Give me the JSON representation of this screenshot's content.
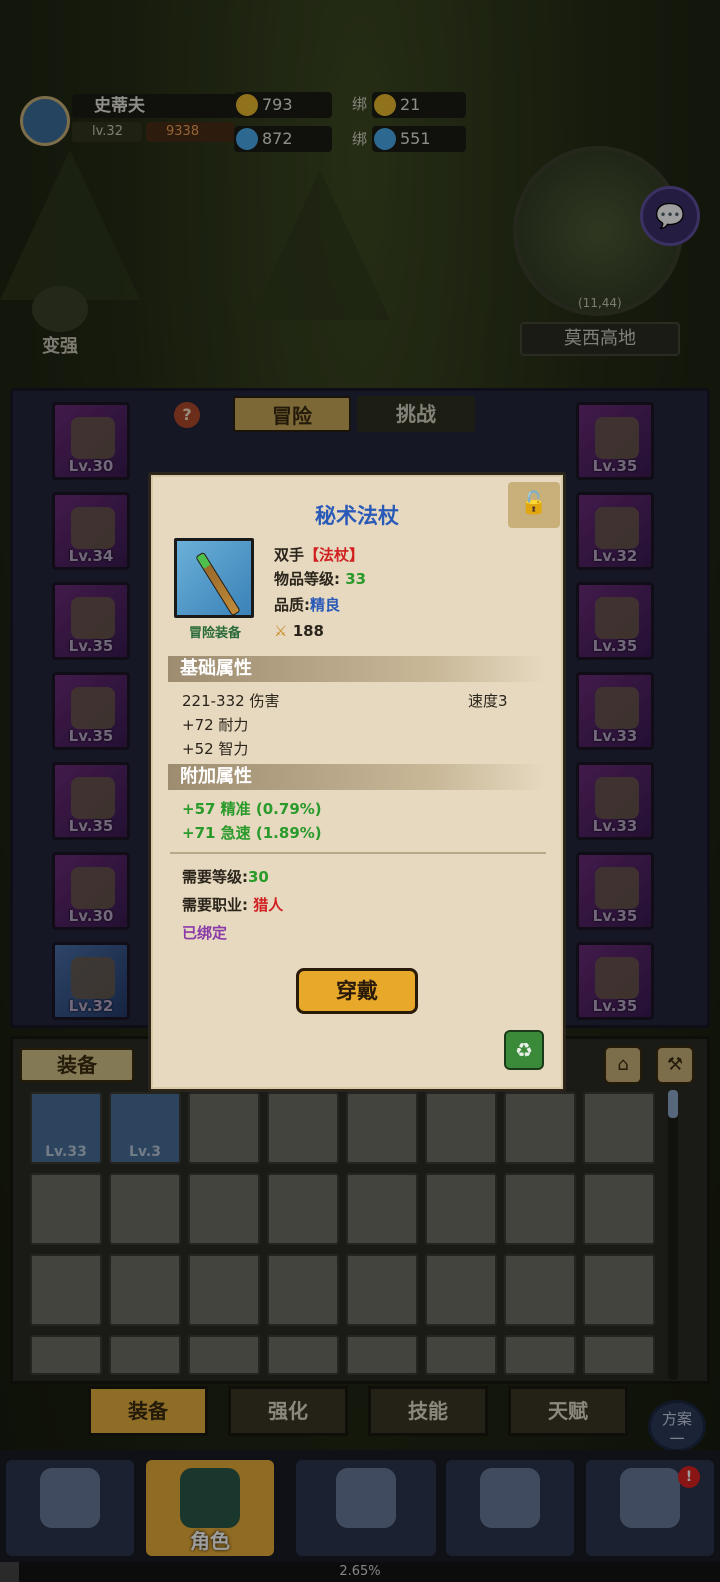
{
  "player": {
    "name": "史蒂夫",
    "level": "lv.32",
    "power": "9338"
  },
  "currency": {
    "gold": "793",
    "bind_label": "绑",
    "bind_gold": "21",
    "gems": "872",
    "bind_gems": "551"
  },
  "map": {
    "name": "莫西高地",
    "coords": "(11,44)"
  },
  "boost_label": "变强",
  "tabs": {
    "adventure": "冒险",
    "challenge": "挑战"
  },
  "left_slots": [
    "Lv.30",
    "Lv.34",
    "Lv.35",
    "Lv.35",
    "Lv.35",
    "Lv.30",
    "Lv.32"
  ],
  "right_slots": [
    "Lv.35",
    "Lv.32",
    "Lv.35",
    "Lv.33",
    "Lv.33",
    "Lv.35",
    "Lv.35"
  ],
  "bag": {
    "tab": "装备",
    "items": [
      "Lv.33",
      "Lv.3"
    ]
  },
  "item": {
    "name": "秘术法杖",
    "hand": "双手",
    "type": "【法杖】",
    "item_level_label": "物品等级:",
    "item_level": "33",
    "quality_label": "品质:",
    "quality": "精良",
    "power": "188",
    "category": "冒险装备",
    "base_title": "基础属性",
    "damage": "221-332 伤害",
    "speed": "速度3",
    "stamina": "+72 耐力",
    "intellect": "+52 智力",
    "extra_title": "附加属性",
    "precision": "+57 精准 (0.79%)",
    "haste": "+71 急速 (1.89%)",
    "req_level_label": "需要等级:",
    "req_level": "30",
    "req_class_label": "需要职业:",
    "req_class": "猎人",
    "bound": "已绑定",
    "equip_button": "穿戴"
  },
  "bottom_tabs": [
    "装备",
    "强化",
    "技能",
    "天赋"
  ],
  "scheme": {
    "line1": "方案",
    "line2": "一"
  },
  "nav": {
    "character": "角色"
  },
  "badge": "!",
  "progress": {
    "value": 2.65,
    "label": "2.65%"
  },
  "colors": {
    "accent": "#e6b23e",
    "item_name": "#2a5ab8",
    "green_stat": "#2a9a2a",
    "red_req": "#d02020",
    "purple_bound": "#8a3aa8"
  }
}
